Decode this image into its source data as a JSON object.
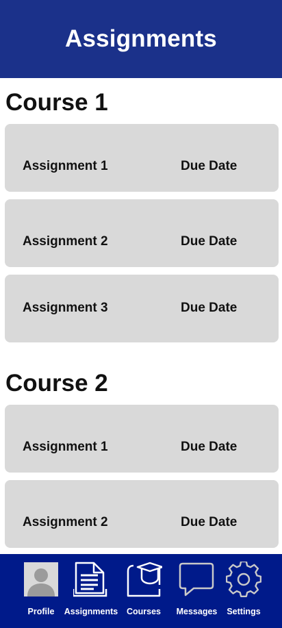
{
  "header": {
    "title": "Assignments"
  },
  "courses": [
    {
      "title": "Course 1",
      "assignments": [
        {
          "name": "Assignment 1",
          "due": "Due Date"
        },
        {
          "name": "Assignment 2",
          "due": "Due Date"
        },
        {
          "name": "Assignment 3",
          "due": "Due Date"
        }
      ]
    },
    {
      "title": "Course 2",
      "assignments": [
        {
          "name": "Assignment 1",
          "due": "Due Date"
        },
        {
          "name": "Assignment 2",
          "due": "Due Date"
        }
      ]
    }
  ],
  "nav": {
    "items": [
      {
        "label": "Profile",
        "icon": "profile-icon"
      },
      {
        "label": "Assignments",
        "icon": "document-icon"
      },
      {
        "label": "Courses",
        "icon": "graduation-cap-icon"
      },
      {
        "label": "Messages",
        "icon": "chat-bubble-icon"
      },
      {
        "label": "Settings",
        "icon": "gear-icon"
      }
    ]
  },
  "colors": {
    "header_bg": "#1b318a",
    "nav_bg": "#001a8a",
    "card_bg": "#d9d9d9",
    "text": "#111111",
    "nav_text": "#ffffff"
  }
}
